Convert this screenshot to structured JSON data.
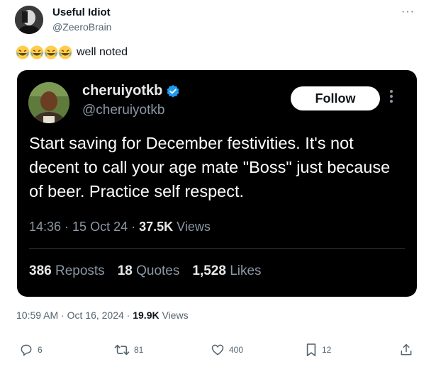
{
  "author": {
    "name": "Useful Idiot",
    "handle": "@ZeeroBrain"
  },
  "menu_icon": "more-horizontal-icon",
  "tweet": {
    "emoji": [
      "😂",
      "😂",
      "😂",
      "😂"
    ],
    "text": "well noted"
  },
  "quoted": {
    "name": "cheruiyotkb",
    "handle": "@cheruiyotkb",
    "verified_icon": "verified-badge-icon",
    "follow_label": "Follow",
    "body": "Start saving for December festivities. It's not decent to call your age mate \"Boss\" just because of beer. Practice self respect.",
    "time": "14:36",
    "date": "15 Oct 24",
    "views_count": "37.5K",
    "views_label": "Views",
    "reposts_count": "386",
    "reposts_label": "Reposts",
    "quotes_count": "18",
    "quotes_label": "Quotes",
    "likes_count": "1,528",
    "likes_label": "Likes",
    "colors": {
      "background": "#000000",
      "muted": "#8b98a5",
      "verified": "#1d9bf0"
    }
  },
  "meta": {
    "time": "10:59 AM",
    "date": "Oct 16, 2024",
    "views_count": "19.9K",
    "views_label": "Views"
  },
  "actions": {
    "replies": "6",
    "reposts": "81",
    "likes": "400",
    "bookmarks": "12"
  }
}
